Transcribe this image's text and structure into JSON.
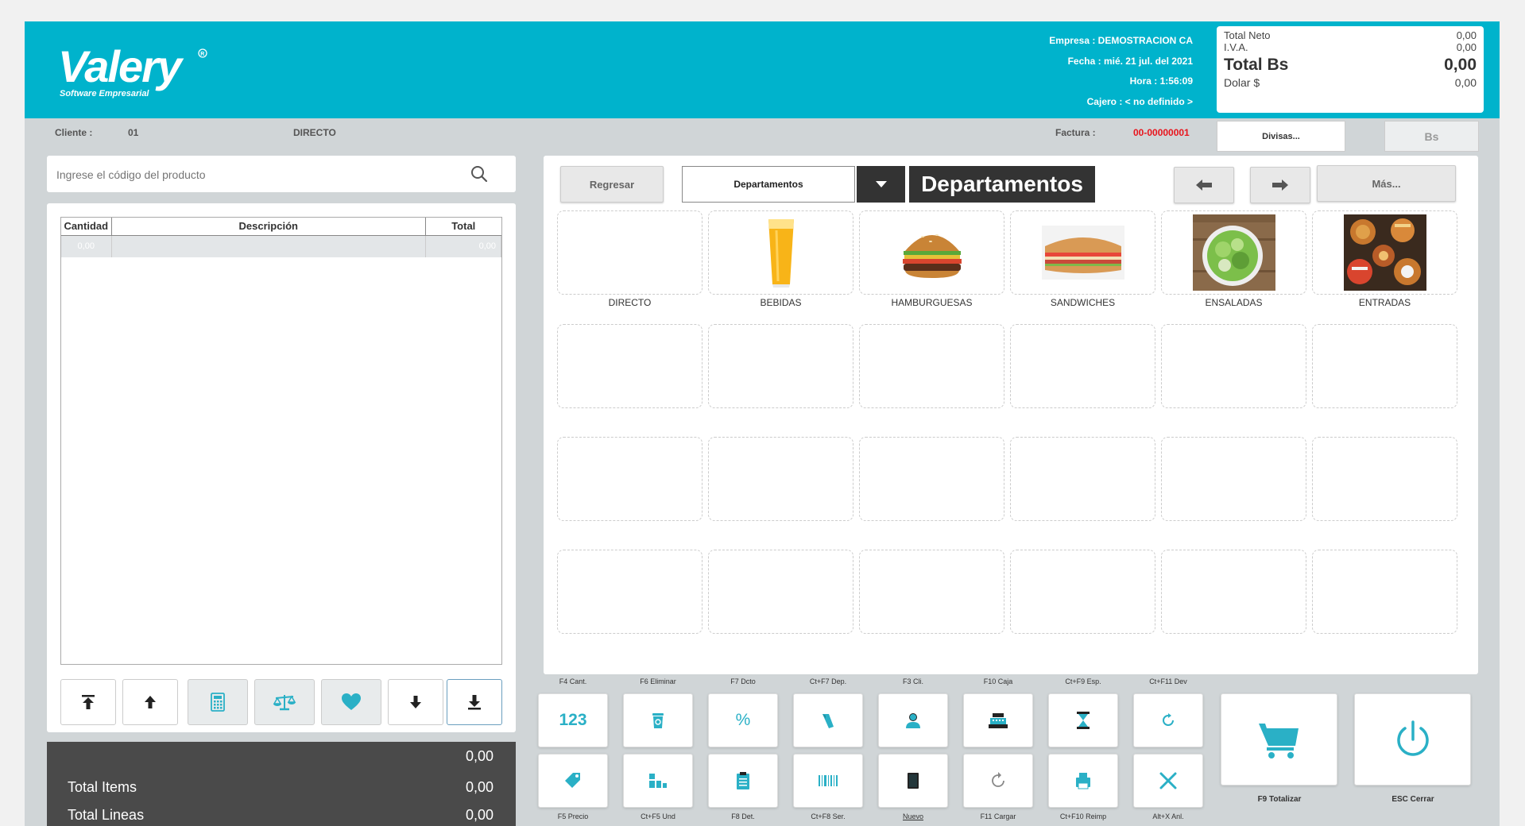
{
  "header": {
    "logo_text": "Valery",
    "logo_sub": "Software Empresarial",
    "empresa": "Empresa : DEMOSTRACION CA",
    "fecha": "Fecha : mié. 21 jul. del 2021",
    "hora": "Hora :  1:56:09",
    "cajero": "Cajero : < no definido >"
  },
  "totals": {
    "neto_label": "Total Neto",
    "neto": "0,00",
    "iva_label": "I.V.A.",
    "iva": "0,00",
    "total_label": "Total Bs",
    "total": "0,00",
    "dolar_label": "Dolar $",
    "dolar": "0,00"
  },
  "customer": {
    "label": "Cliente :",
    "code": "01",
    "name": "DIRECTO",
    "factura_label": "Factura :",
    "factura": "00-00000001",
    "divisas_btn": "Divisas...",
    "bs_btn": "Bs"
  },
  "search": {
    "placeholder": "Ingrese el código del producto"
  },
  "grid": {
    "columns": [
      "Cantidad",
      "Descripción",
      "Total"
    ],
    "row": {
      "qty": "0,00",
      "desc": "",
      "total": "0,00"
    }
  },
  "summary": {
    "top_value": "0,00",
    "items_label": "Total Items",
    "items": "0,00",
    "lines_label": "Total Lineas",
    "lines": "0,00"
  },
  "departments": {
    "back_btn": "Regresar",
    "select_value": "Departamentos",
    "title": "Departamentos",
    "more_btn": "Más...",
    "tiles": [
      {
        "label": "DIRECTO",
        "icon": "none"
      },
      {
        "label": "BEBIDAS",
        "icon": "juice-glass"
      },
      {
        "label": "HAMBURGUESAS",
        "icon": "burger"
      },
      {
        "label": "SANDWICHES",
        "icon": "sandwich"
      },
      {
        "label": "ENSALADAS",
        "icon": "salad"
      },
      {
        "label": "ENTRADAS",
        "icon": "appetizers"
      }
    ]
  },
  "function_keys": {
    "top_labels": [
      "F4 Cant.",
      "F6 Eliminar",
      "F7 Dcto",
      "Ct+F7 Dep.",
      "F3 Cli.",
      "F10 Caja",
      "Ct+F9 Esp.",
      "Ct+F11 Dev"
    ],
    "bottom_labels": [
      "F5 Precio",
      "Ct+F5 Und",
      "F8 Det.",
      "Ct+F8 Ser.",
      "Nuevo",
      "F11 Cargar",
      "Ct+F10 Reimp",
      "Alt+X Anl."
    ],
    "key_123": "123",
    "key_pct": "%",
    "totalizar": "F9 Totalizar",
    "cerrar": "ESC Cerrar"
  },
  "colors": {
    "brand": "#00b3cc",
    "accent_icon": "#2ab0c6",
    "factura_red": "#e8141c",
    "dark": "#333333"
  }
}
